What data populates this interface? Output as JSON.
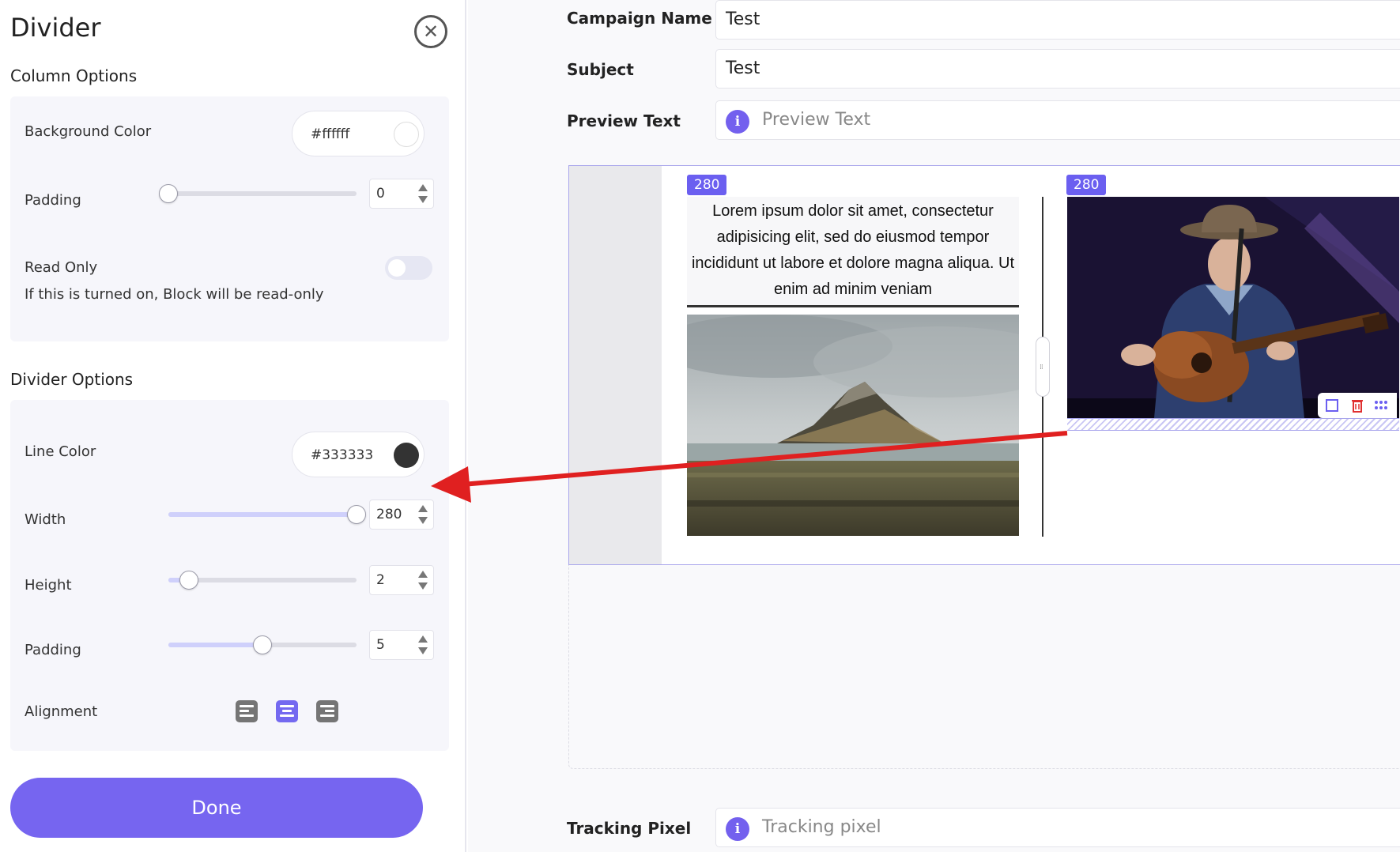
{
  "panel": {
    "title": "Divider",
    "column_options": {
      "heading": "Column Options",
      "background_color": {
        "label": "Background Color",
        "value": "#ffffff"
      },
      "padding": {
        "label": "Padding",
        "value": "0",
        "fraction": 0.0
      },
      "read_only": {
        "label": "Read Only",
        "description": "If this is turned on, Block will be read-only",
        "enabled": false
      }
    },
    "divider_options": {
      "heading": "Divider Options",
      "line_color": {
        "label": "Line Color",
        "value": "#333333"
      },
      "width": {
        "label": "Width",
        "value": "280",
        "fraction": 1.0
      },
      "height": {
        "label": "Height",
        "value": "2",
        "fraction": 0.11
      },
      "padding": {
        "label": "Padding",
        "value": "5",
        "fraction": 0.5
      },
      "alignment": {
        "label": "Alignment",
        "options": [
          "left",
          "center",
          "right"
        ],
        "selected": "center"
      }
    },
    "done_label": "Done"
  },
  "editor": {
    "campaign_name": {
      "label": "Campaign Name",
      "value": "Test"
    },
    "subject": {
      "label": "Subject",
      "value": "Test"
    },
    "preview_text": {
      "label": "Preview Text",
      "placeholder": "Preview Text"
    },
    "tracking_pixel": {
      "label": "Tracking Pixel",
      "placeholder": "Tracking pixel"
    },
    "columns": [
      {
        "width_badge": "280",
        "text": "Lorem ipsum dolor sit amet, consectetur adipisicing elit, sed do eiusmod tempor incididunt ut labore et dolore magna aliqua. Ut enim ad minim veniam"
      },
      {
        "width_badge": "280"
      }
    ]
  },
  "colors": {
    "accent": "#7665f0",
    "arrow": "#e02020",
    "line": "#333333"
  },
  "icons": [
    "close-icon",
    "info-icon",
    "align-left-icon",
    "align-center-icon",
    "align-right-icon",
    "duplicate-icon",
    "trash-icon",
    "drag-dots-icon"
  ]
}
